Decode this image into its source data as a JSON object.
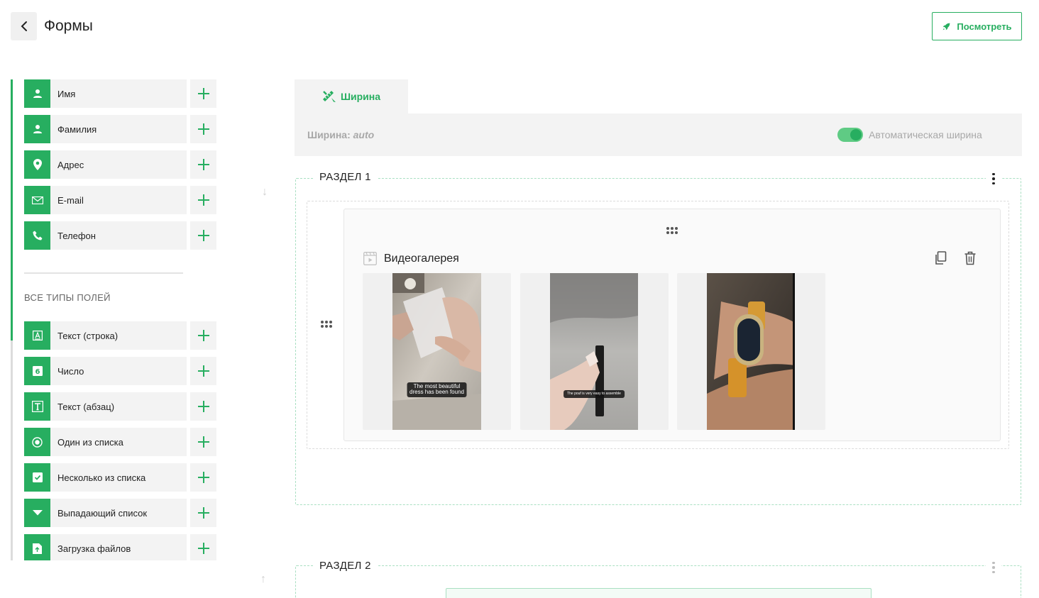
{
  "header": {
    "title": "Формы",
    "view_button": "Посмотреть"
  },
  "sidebar": {
    "quick_fields": [
      {
        "label": "Имя",
        "icon": "person-icon"
      },
      {
        "label": "Фамилия",
        "icon": "person-icon"
      },
      {
        "label": "Адрес",
        "icon": "location-pin-icon"
      },
      {
        "label": "E-mail",
        "icon": "envelope-icon"
      },
      {
        "label": "Телефон",
        "icon": "phone-icon"
      }
    ],
    "all_types_heading": "ВСЕ ТИПЫ ПОЛЕЙ",
    "all_types": [
      {
        "label": "Текст (строка)",
        "icon": "text-line-icon"
      },
      {
        "label": "Число",
        "icon": "number-icon"
      },
      {
        "label": "Текст (абзац)",
        "icon": "text-paragraph-icon"
      },
      {
        "label": "Один из списка",
        "icon": "radio-icon"
      },
      {
        "label": "Несколько из списка",
        "icon": "checkbox-icon"
      },
      {
        "label": "Выпадающий список",
        "icon": "dropdown-icon"
      },
      {
        "label": "Загрузка файлов",
        "icon": "file-upload-icon"
      }
    ]
  },
  "width_panel": {
    "tab_label": "Ширина",
    "width_label": "Ширина:",
    "width_value": "auto",
    "auto_width_label": "Автоматическая ширина",
    "auto_width_enabled": true
  },
  "sections": [
    {
      "title": "РАЗДЕЛ 1",
      "block": {
        "title": "Видеогалерея",
        "videos": [
          {
            "caption_line1": "The most beautiful",
            "caption_line2": "dress has been found"
          },
          {
            "caption_line1": "The pouf is very easy to assemble",
            "caption_line2": ""
          },
          {
            "caption_line1": "",
            "caption_line2": ""
          }
        ]
      }
    },
    {
      "title": "РАЗДЕЛ 2"
    }
  ],
  "colors": {
    "accent": "#27ae60",
    "panel_bg": "#f3f3f3",
    "dashed_border": "#a9dfc2"
  }
}
